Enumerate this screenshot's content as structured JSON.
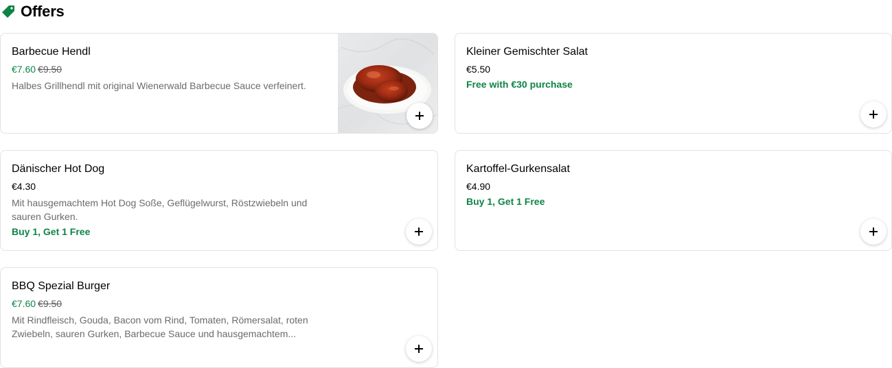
{
  "section": {
    "title": "Offers",
    "icon": "tag-icon"
  },
  "colors": {
    "promo_green": "#0e8345",
    "border": "#e2e2e2"
  },
  "offers": [
    {
      "name": "Barbecue Hendl",
      "price": "€7.60",
      "original_price": "€9.50",
      "description": "Halbes Grillhendl mit original Wienerwald Barbecue Sauce verfeinert.",
      "promo": "",
      "has_image": true
    },
    {
      "name": "Kleiner Gemischter Salat",
      "price": "€5.50",
      "original_price": "",
      "description": "",
      "promo": "Free with €30 purchase",
      "has_image": false
    },
    {
      "name": "Dänischer Hot Dog",
      "price": "€4.30",
      "original_price": "",
      "description": "Mit hausgemachtem Hot Dog Soße, Geflügelwurst, Röstzwiebeln und sauren Gurken.",
      "promo": "Buy 1, Get 1 Free",
      "has_image": false
    },
    {
      "name": "Kartoffel-Gurkensalat",
      "price": "€4.90",
      "original_price": "",
      "description": "",
      "promo": "Buy 1, Get 1 Free",
      "has_image": false
    },
    {
      "name": "BBQ Spezial Burger",
      "price": "€7.60",
      "original_price": "€9.50",
      "description": "Mit Rindfleisch, Gouda, Bacon vom Rind, Tomaten, Römersalat, roten Zwiebeln, sauren Gurken, Barbecue Sauce und hausgemachtem...",
      "promo": "",
      "has_image": false
    }
  ]
}
